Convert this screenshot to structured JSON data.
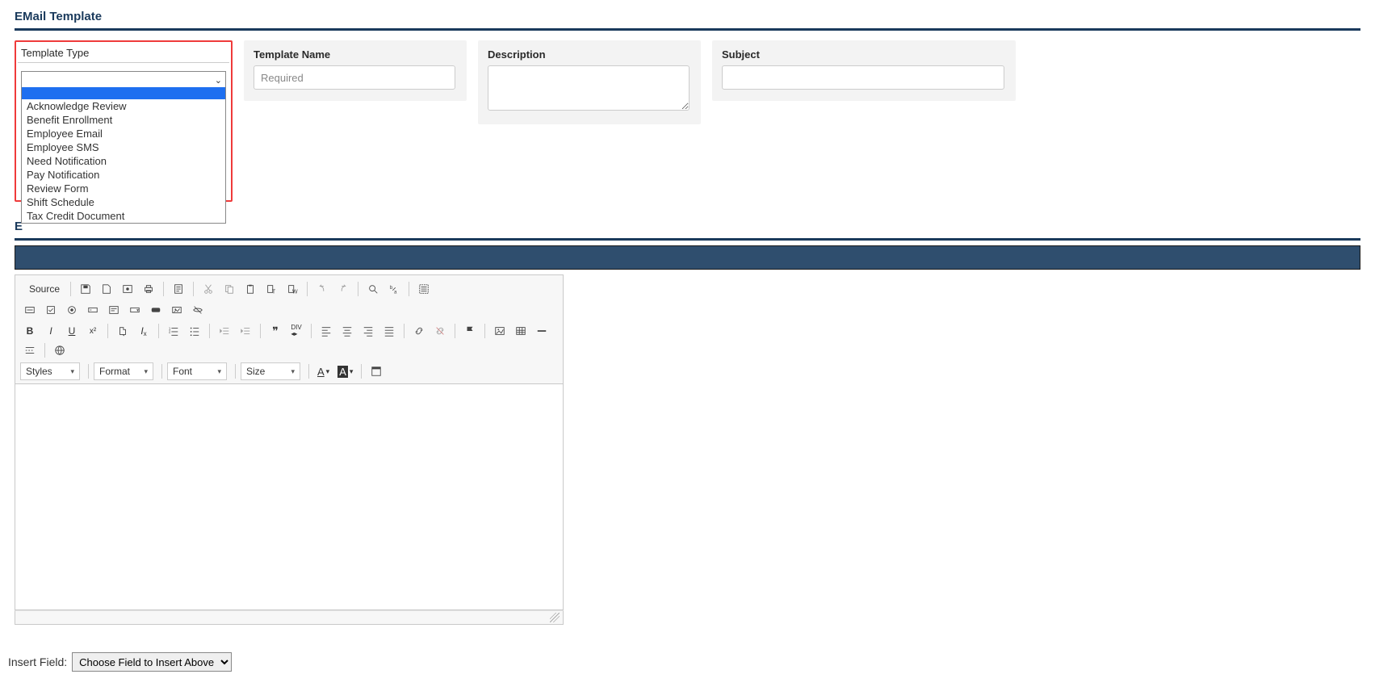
{
  "section_title": "EMail Template",
  "fields": {
    "template_type": {
      "label": "Template Type",
      "options": [
        "",
        "Acknowledge Review",
        "Benefit Enrollment",
        "Employee Email",
        "Employee SMS",
        "Need Notification",
        "Pay Notification",
        "Review Form",
        "Shift Schedule",
        "Tax Credit Document"
      ]
    },
    "template_name": {
      "label": "Template Name",
      "placeholder": "Required"
    },
    "description": {
      "label": "Description"
    },
    "subject": {
      "label": "Subject"
    }
  },
  "edit_section_prefix": "E",
  "editor": {
    "source_label": "Source",
    "combos": {
      "styles": "Styles",
      "format": "Format",
      "font": "Font",
      "size": "Size"
    }
  },
  "insert_field": {
    "label": "Insert Field:",
    "selected": "Choose Field to Insert Above"
  }
}
